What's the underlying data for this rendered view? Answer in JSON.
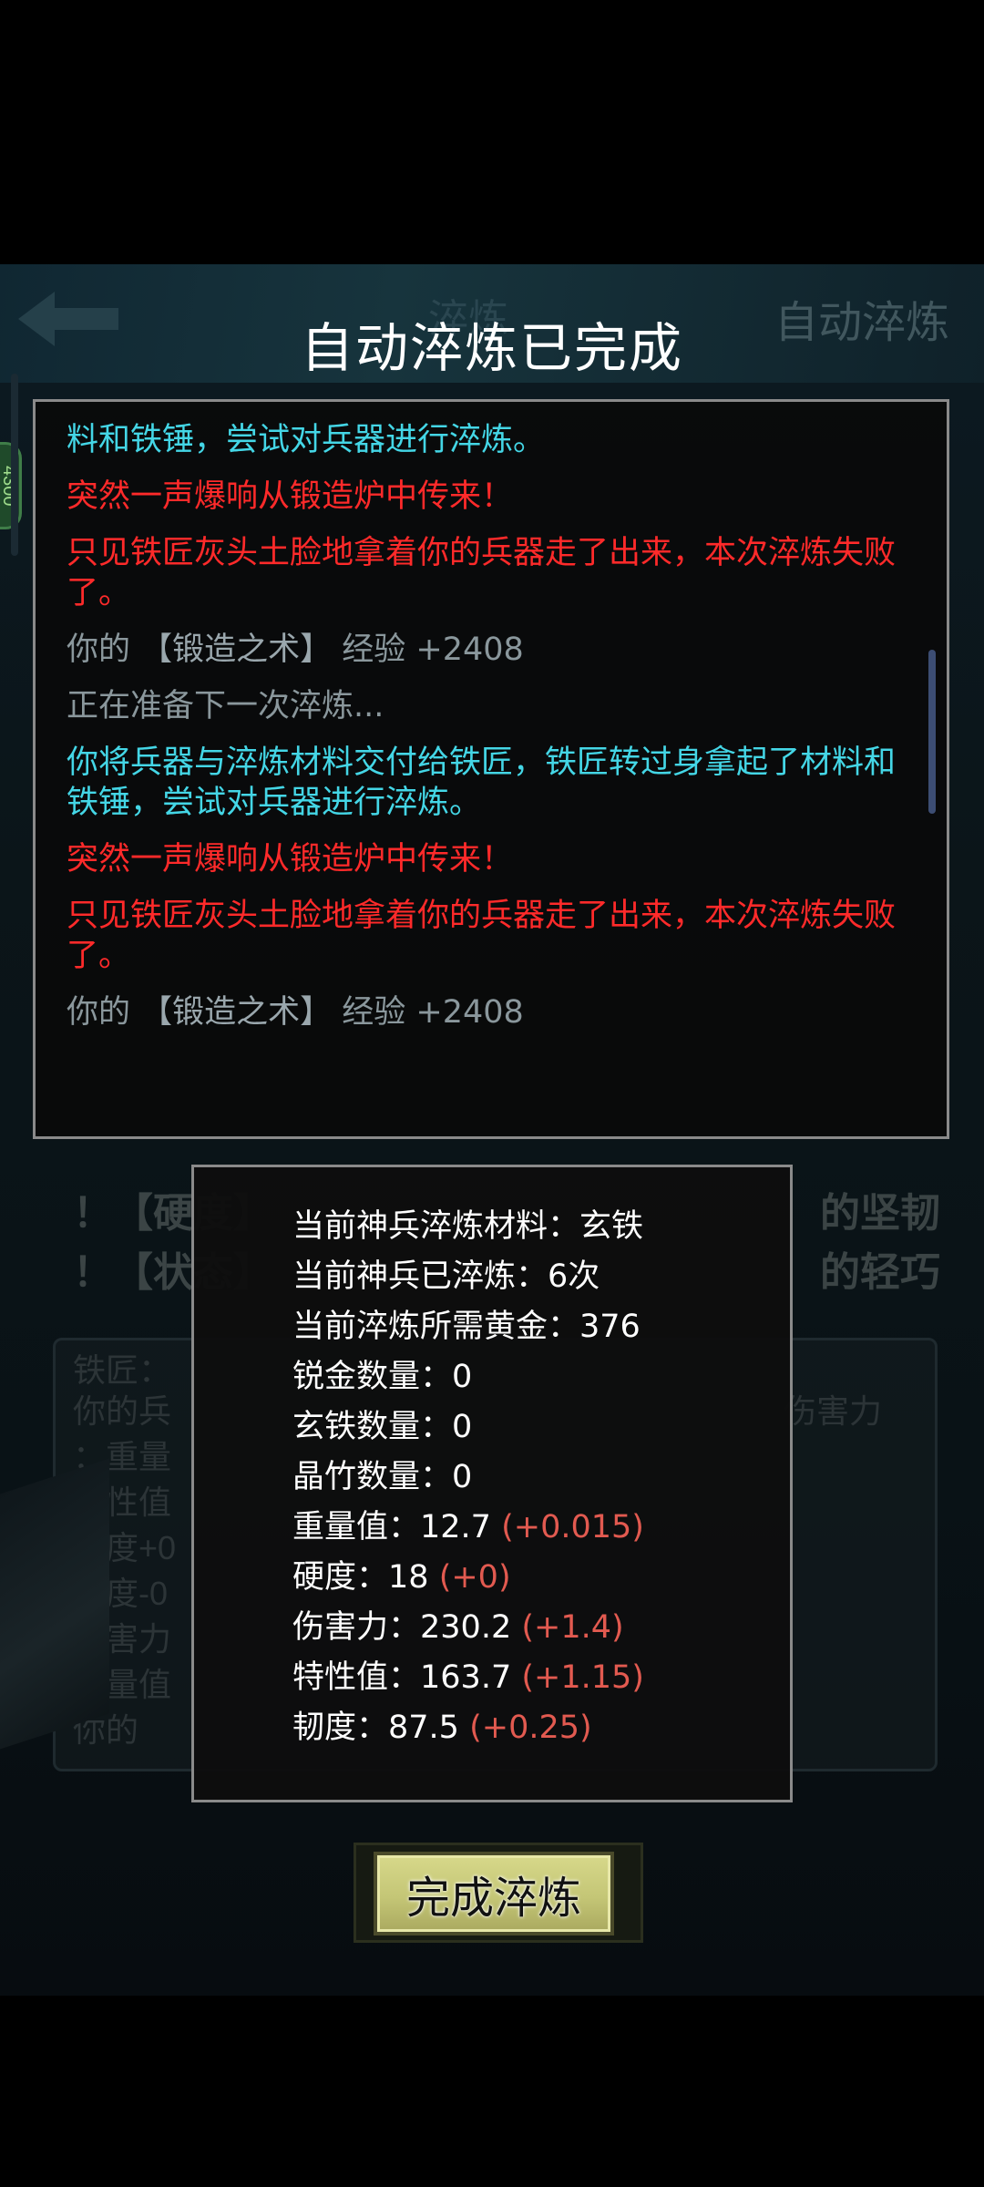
{
  "background": {
    "header_title": "淬炼",
    "right_title": "自动淬炼",
    "side_badge": "4300",
    "lines": [
      "！【硬度】",
      "！【状态】",
      "的坚韧",
      "的轻巧"
    ],
    "inner_panel_lines": [
      "铁匠：",
      "你的兵",
      "：重量",
      "特性值",
      "硬度+0",
      "韧度-0",
      "伤害力",
      "重量值",
      "你的",
      "伤害力"
    ]
  },
  "dialog": {
    "title": "自动淬炼已完成"
  },
  "log": {
    "lines": [
      {
        "type": "cyan",
        "text": "料和铁锤，尝试对兵器进行淬炼。"
      },
      {
        "type": "red",
        "text": "突然一声爆响从锻造炉中传来！"
      },
      {
        "type": "red",
        "text": "只见铁匠灰头土脸地拿着你的兵器走了出来，本次淬炼失败了。"
      },
      {
        "type": "gray",
        "prefix": "你的 ",
        "skill": "【锻造之术】",
        "suffix": " 经验 +2408"
      },
      {
        "type": "gray",
        "text": "正在准备下一次淬炼..."
      },
      {
        "type": "cyan",
        "text": "你将兵器与淬炼材料交付给铁匠，铁匠转过身拿起了材料和铁锤，尝试对兵器进行淬炼。"
      },
      {
        "type": "red",
        "text": "突然一声爆响从锻造炉中传来！"
      },
      {
        "type": "red",
        "text": "只见铁匠灰头土脸地拿着你的兵器走了出来，本次淬炼失败了。"
      },
      {
        "type": "gray",
        "prefix": "你的 ",
        "skill": "【锻造之术】",
        "suffix": " 经验 +2408"
      }
    ]
  },
  "stats": {
    "material_label": "当前神兵淬炼材料：",
    "material_value": "玄铁",
    "refined_label": "当前神兵已淬炼：",
    "refined_value": "6次",
    "gold_label": "当前淬炼所需黄金：",
    "gold_value": "376",
    "ruijin_label": "锐金数量：",
    "ruijin_value": "0",
    "xuantie_label": "玄铁数量：",
    "xuantie_value": "0",
    "jingzhu_label": "晶竹数量：",
    "jingzhu_value": "0",
    "weight_label": "重量值：",
    "weight_value": "12.7",
    "weight_delta": "(+0.015)",
    "hardness_label": "硬度：",
    "hardness_value": "18",
    "hardness_delta": "(+0)",
    "damage_label": "伤害力：",
    "damage_value": "230.2",
    "damage_delta": "(+1.4)",
    "trait_label": "特性值：",
    "trait_value": "163.7",
    "trait_delta": "(+1.15)",
    "toughness_label": "韧度：",
    "toughness_value": "87.5",
    "toughness_delta": "(+0.25)"
  },
  "finish_button": {
    "label": "完成淬炼"
  },
  "colors": {
    "cyan_text": "#44d6e6",
    "red_text": "#ff2a2a",
    "gray_text": "#8a979c",
    "delta_text": "#e25a50",
    "button_fill": "#c4c676"
  }
}
